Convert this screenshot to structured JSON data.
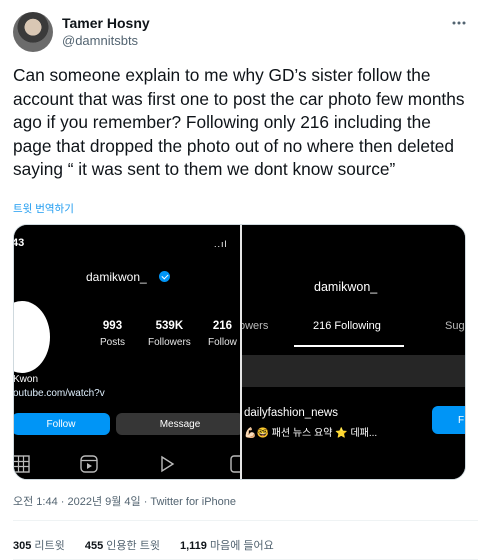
{
  "author": {
    "name": "Tamer Hosny",
    "handle": "@damnitsbts"
  },
  "tweet": {
    "text": "Can someone explain to me why GD’s sister follow the account that was first one to post the car photo few months ago if you remember? Following only 216 including the page that dropped the photo out of no where then deleted saying “ it was sent to them we dont know source”",
    "translate_label": "트윗 번역하기",
    "timestamp": "오전 1:44 · 2022년 9월 4일 · Twitter for iPhone"
  },
  "media": {
    "left": {
      "time": "43",
      "status_glyphs": "..ıl",
      "username": "damikwon_",
      "stats": [
        {
          "num": "993",
          "label": "Posts"
        },
        {
          "num": "539K",
          "label": "Followers"
        },
        {
          "num": "216",
          "label": "Follow"
        }
      ],
      "bio_name": "Kwon",
      "bio_link": "outube.com/watch?v",
      "follow_label": "Follow",
      "message_label": "Message"
    },
    "right": {
      "username": "damikwon_",
      "tabs": [
        {
          "label": "owers"
        },
        {
          "label": "216 Following"
        },
        {
          "label": "Sug"
        }
      ],
      "account_name": "dailyfashion_news",
      "account_desc": "💪🏻🤓 패션 뉴스 요약 ⭐ 데패...",
      "follow_label": "F"
    }
  },
  "stats": {
    "retweets_count": "305",
    "retweets_label": "리트윗",
    "quotes_count": "455",
    "quotes_label": "인용한 트윗",
    "likes_count": "1,119",
    "likes_label": "마음에 들어요"
  }
}
